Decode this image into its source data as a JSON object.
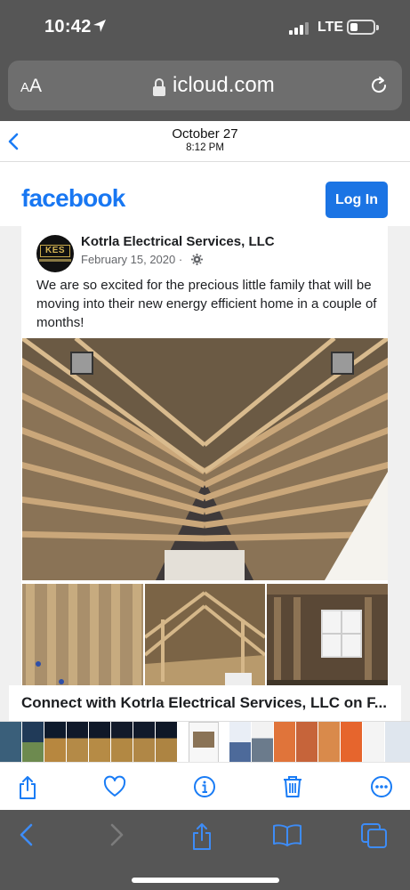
{
  "status_bar": {
    "time": "10:42",
    "network": "LTE"
  },
  "url_bar": {
    "text_size_button": "AA",
    "url": "icloud.com"
  },
  "viewer_header": {
    "date": "October 27",
    "time": "8:12 PM"
  },
  "facebook": {
    "logo": "facebook",
    "login_label": "Log In",
    "post": {
      "avatar_text": "KES",
      "page_name": "Kotrla Electrical Services, LLC",
      "date": "February 15, 2020 ·",
      "text": "We are so excited for the precious little family that will be moving into their new energy efficient home in a couple of months!"
    },
    "connect_banner": "Connect with Kotrla Electrical Services, LLC on F..."
  },
  "photo_toolbar": {
    "icons": [
      "share-icon",
      "heart-icon",
      "info-icon",
      "trash-icon",
      "more-icon"
    ]
  },
  "safari_toolbar": {
    "icons": [
      "back-icon",
      "forward-icon",
      "share-icon",
      "bookmarks-icon",
      "tabs-icon"
    ]
  },
  "colors": {
    "facebook_blue": "#1877f2",
    "ios_blue": "#1a7cf5",
    "chrome_gray": "#565656"
  }
}
